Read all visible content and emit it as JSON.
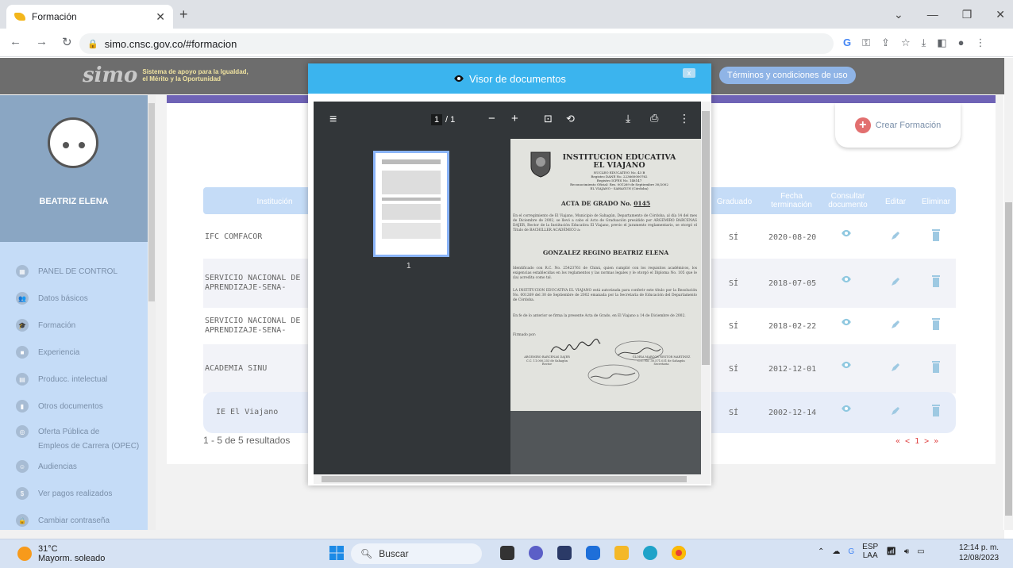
{
  "browser": {
    "tab_title": "Formación",
    "url": "simo.cnsc.gov.co/#formacion"
  },
  "header": {
    "logo": "simo",
    "tagline_1": "Sistema de apoyo para la Igualdad,",
    "tagline_2": "el Mérito y la Oportunidad",
    "terms": "Términos y condiciones de uso"
  },
  "sidebar": {
    "user_name": "BEATRIZ ELENA",
    "items": [
      {
        "label": "PANEL DE CONTROL",
        "icon": "dashboard-icon"
      },
      {
        "label": "Datos básicos",
        "icon": "people-icon"
      },
      {
        "label": "Formación",
        "icon": "graduation-icon"
      },
      {
        "label": "Experiencia",
        "icon": "briefcase-icon"
      },
      {
        "label": "Producc. intelectual",
        "icon": "document-icon"
      },
      {
        "label": "Otros documentos",
        "icon": "file-icon"
      },
      {
        "label": "Oferta Pública de",
        "icon": "globe-icon"
      },
      {
        "label": "Empleos de Carrera (OPEC)",
        "icon": ""
      },
      {
        "label": "Audiencias",
        "icon": "audience-icon"
      },
      {
        "label": "Ver pagos realizados",
        "icon": "dollar-icon"
      },
      {
        "label": "Cambiar contraseña",
        "icon": "lock-icon"
      }
    ]
  },
  "main": {
    "create_button": "Crear Formación",
    "columns": {
      "institucion": "Institución",
      "graduado": "Graduado",
      "fecha_1": "Fecha",
      "fecha_2": "terminación",
      "consultar_1": "Consultar",
      "consultar_2": "documento",
      "editar": "Editar",
      "eliminar": "Eliminar"
    },
    "rows": [
      {
        "institucion": "IFC COMFACOR",
        "graduado": "SÍ",
        "fecha": "2020-08-20"
      },
      {
        "institucion": "SERVICIO NACIONAL DE APRENDIZAJE-SENA-",
        "graduado": "SÍ",
        "fecha": "2018-07-05"
      },
      {
        "institucion": "SERVICIO NACIONAL DE APRENDIZAJE-SENA-",
        "graduado": "SÍ",
        "fecha": "2018-02-22"
      },
      {
        "institucion": "ACADEMIA SINU",
        "graduado": "SÍ",
        "fecha": "2012-12-01"
      },
      {
        "institucion": "IE El Viajano",
        "graduado": "SÍ",
        "fecha": "2002-12-14"
      }
    ],
    "results": "1 - 5 de 5 resultados",
    "pager": "«  <  1  >  »"
  },
  "modal": {
    "title": "Visor de documentos",
    "close": "x",
    "pdf": {
      "page_current": "1",
      "page_total": "/ 1",
      "thumb_label": "1"
    },
    "document": {
      "inst_1": "INSTITUCION EDUCATIVA",
      "inst_2": "EL VIAJANO",
      "sub_1": "NUCLEO EDUCATIVO No. 43 B",
      "sub_2": "Registro DANE No. 223660000762",
      "sub_3": "Registro ICFES No. 148147",
      "sub_4": "Reconocimiento Oficial: Res. 001269 de Septiembre 30/2002",
      "sub_5": "EL VIAJANO - SAHAGUN (Córdoba)",
      "acta": "ACTA DE GRADO No.",
      "acta_no": "0145",
      "para_1": "En el corregimiento de El Viajano, Municipio de Sahagún, Departamento de Córdoba, al día 14 del mes de Diciembre de 2002, se llevó a cabo el Acto de Graduación presidido por ARGEMIRO BARCENAS DAJER, Rector de la Institución Educativa El Viajano, previo el juramento reglamentario, se otorgó el Título de BACHILLER ACADÉMICO a:",
      "graduate": "GONZALEZ REGINO BEATRIZ ELENA",
      "para_2": "Identificado con R.C. No. 25423761 de Chinú, quien cumplió con los requisitos académicos, los exigencias establecidas en los reglamentos y las normas legales y le otorgó el Diploma No. 105 que le (la) acredita como tal.",
      "para_3": "LA INSTITUCION EDUCATIVA EL VIAJANO está autorizada para conferir este título por la Resolución No. 001269 del 30 de Septiembre de 2002 emanada por la Secretaría de Educación del Departamento de Córdoba.",
      "para_4": "En fe de lo anterior se firma la presente Acta de Grado, en El Viajano a 14 de Diciembre de 2002.",
      "firmado": "Firmado por:",
      "sig_1_name": "ARGEMIRO BARCENAS DAJER",
      "sig_1_id": "C.C. 11.000.253 de Sahagún",
      "sig_1_role": "Rector",
      "sig_2_name": "GLORIA MARCOS NESTOR MARTINEZ",
      "sig_2_id": "C.C. No. 30.571.031 de Sahagún",
      "sig_2_role": "Secretaria"
    }
  },
  "taskbar": {
    "temp": "31°C",
    "weather": "Mayorm. soleado",
    "search": "Buscar",
    "lang_1": "ESP",
    "lang_2": "LAA",
    "time": "12:14 p. m.",
    "date": "12/08/2023"
  }
}
